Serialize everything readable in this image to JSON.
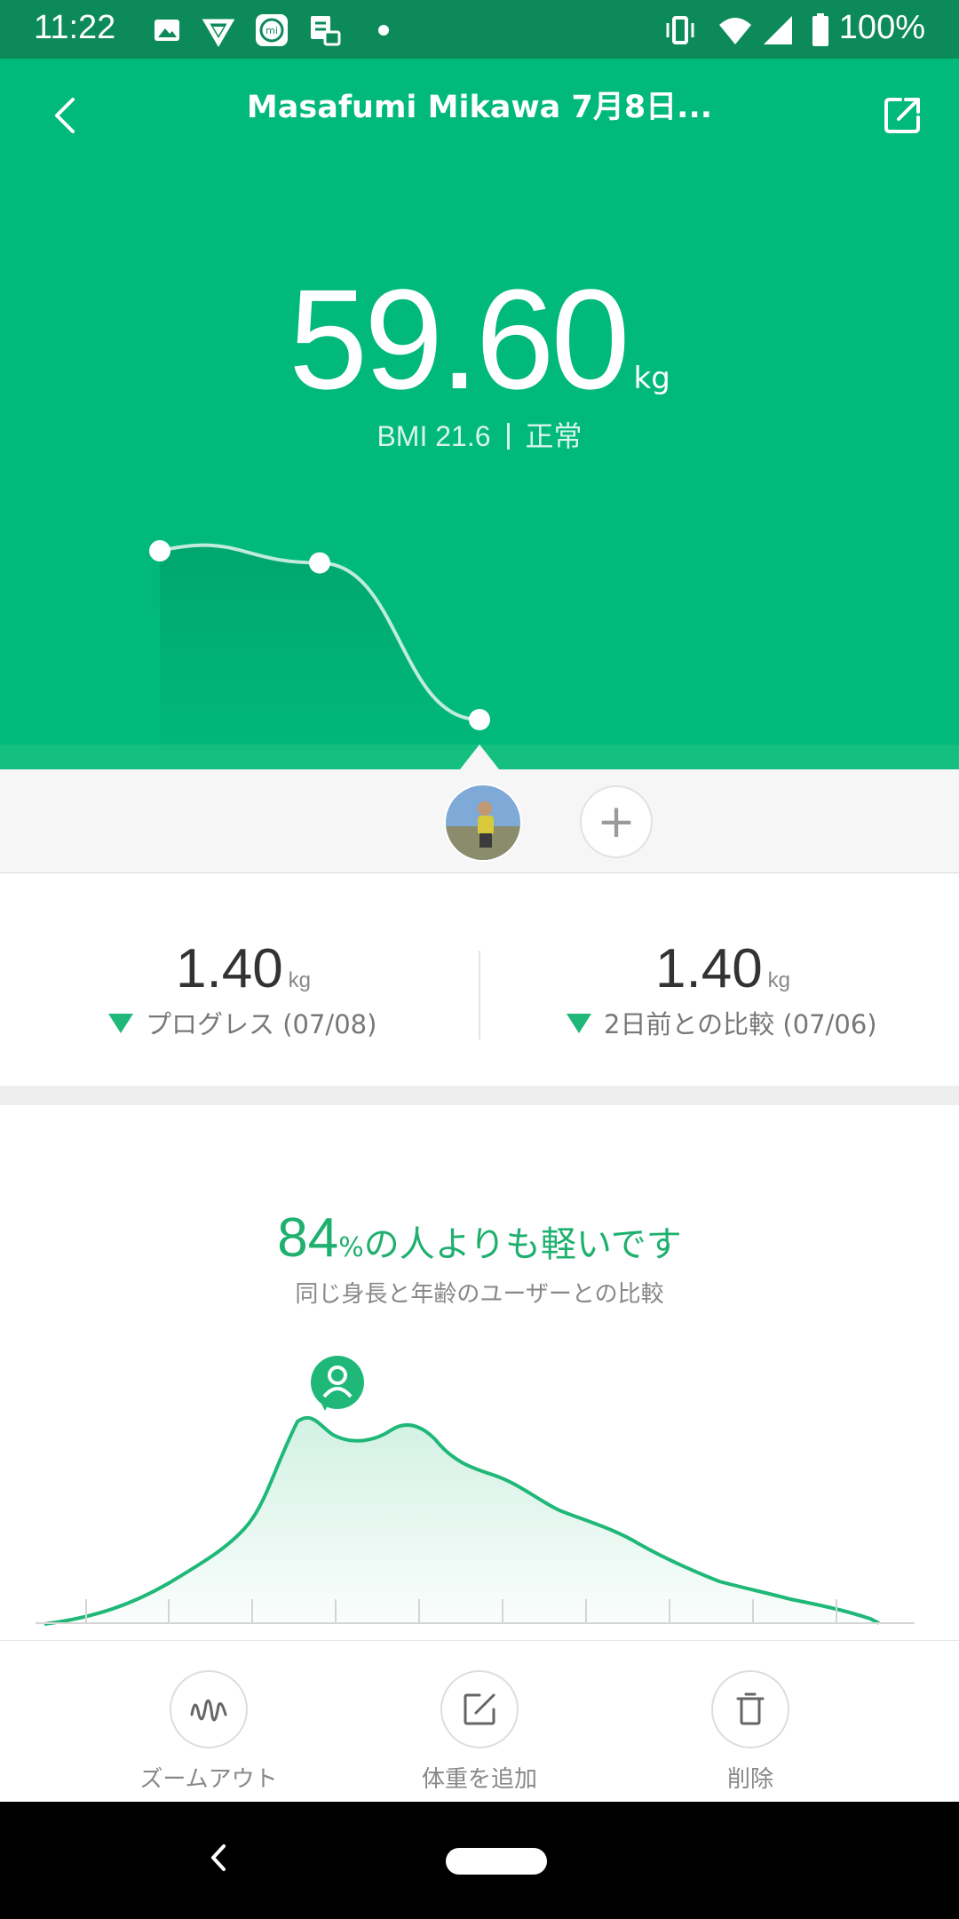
{
  "status_bar": {
    "time": "11:22",
    "battery": "100%"
  },
  "header": {
    "title": "Masafumi Mikawa 7月8日..."
  },
  "measurement": {
    "weight": "59.60",
    "unit": "kg",
    "bmi": "BMI 21.6",
    "bmi_status": "正常",
    "trend_points": [
      61.0,
      60.9,
      59.6
    ]
  },
  "stats": [
    {
      "value": "1.40",
      "unit": "kg",
      "label": "プログレス (07/08)"
    },
    {
      "value": "1.40",
      "unit": "kg",
      "label": "2日前との比較 (07/06)"
    }
  ],
  "comparison": {
    "percent": "84",
    "percent_sign": "%",
    "title_suffix": "の人よりも軽いです",
    "subtitle": "同じ身長と年齢のユーザーとの比較"
  },
  "actions": [
    {
      "label": "ズームアウト",
      "icon": "zoom-out-wave-icon"
    },
    {
      "label": "体重を追加",
      "icon": "edit-icon"
    },
    {
      "label": "削除",
      "icon": "trash-icon"
    }
  ],
  "colors": {
    "accent": "#00b97a",
    "accent_dark": "#0c8a5a",
    "text_green": "#1fb06f"
  }
}
